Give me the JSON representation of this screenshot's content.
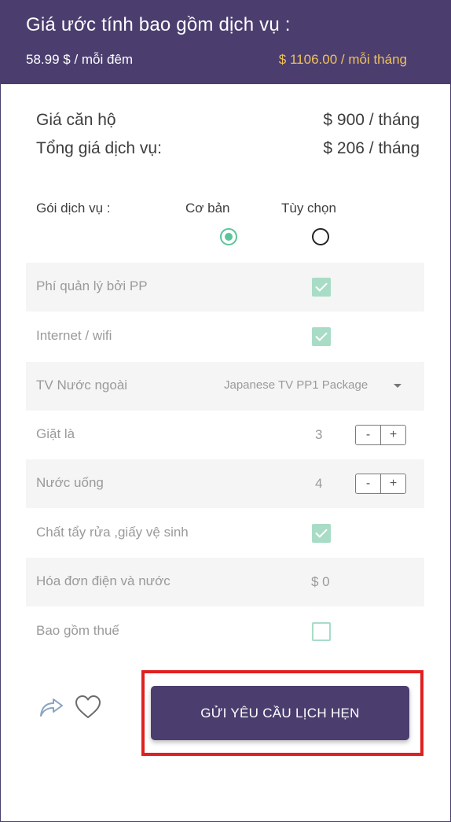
{
  "header": {
    "title": "Giá ước tính bao gồm dịch vụ :",
    "price_night": "58.99 $ / mỗi đêm",
    "price_month": "$ 1106.00 / mỗi tháng"
  },
  "summary": [
    {
      "label": "Giá căn hộ",
      "value": "$ 900 / tháng"
    },
    {
      "label": "Tổng giá dịch vụ:",
      "value": "$ 206 / tháng"
    }
  ],
  "plan": {
    "label": "Gói dịch vụ :",
    "options": [
      {
        "label": "Cơ bản",
        "selected": true
      },
      {
        "label": "Tùy chọn",
        "selected": false
      }
    ]
  },
  "services": [
    {
      "label": "Phí quản lý bởi PP",
      "control": "checkbox",
      "checked": true
    },
    {
      "label": "Internet / wifi",
      "control": "checkbox",
      "checked": true
    },
    {
      "label": "TV Nước ngoài",
      "control": "select",
      "value": "Japanese TV PP1 Package"
    },
    {
      "label": "Giặt là",
      "control": "stepper",
      "value": "3",
      "minus": "-",
      "plus": "+"
    },
    {
      "label": "Nước uống",
      "control": "stepper",
      "value": "4",
      "minus": "-",
      "plus": "+"
    },
    {
      "label": "Chất tẩy rửa ,giấy vệ sinh",
      "control": "checkbox",
      "checked": true
    },
    {
      "label": "Hóa đơn điện và nước",
      "control": "money",
      "value": "$ 0"
    },
    {
      "label": "Bao gồm thuế",
      "control": "checkbox",
      "checked": false
    }
  ],
  "actions": {
    "share_icon": "share-icon",
    "favorite_icon": "heart-icon",
    "submit_label": "GỬI YÊU CẦU LỊCH HẸN"
  },
  "colors": {
    "brand": "#4b3e6f",
    "accent_price": "#f0c15a",
    "check_green": "#a8dcc6",
    "radio_green": "#5cc49b",
    "highlight": "#e02020"
  }
}
